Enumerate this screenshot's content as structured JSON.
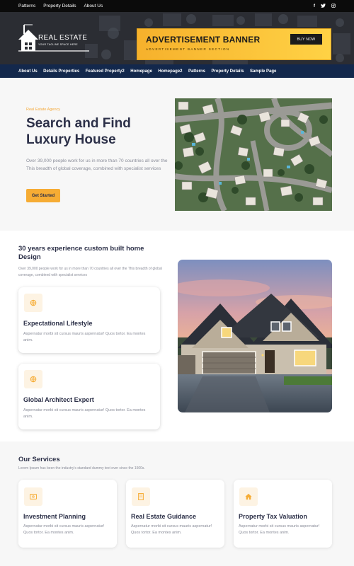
{
  "topbar": {
    "links": [
      "Patterns",
      "Property Details",
      "About Us"
    ],
    "social": [
      "f",
      "t",
      "o"
    ]
  },
  "header": {
    "logo_title": "REAL ESTATE",
    "logo_tagline": "YOUR TAGLINE SPACE HERE",
    "ad_title": "ADVERTISEMENT BANNER",
    "ad_subtitle": "ADVERTISEMENT BANNER SECTION",
    "ad_button": "BUY NOW"
  },
  "nav": {
    "items": [
      "About Us",
      "Details Properties",
      "Featured Property2",
      "Homepage",
      "Homepage2",
      "Patterns",
      "Property Details",
      "Sample Page"
    ]
  },
  "hero": {
    "tag": "Real Estate Agency",
    "title": "Search and Find Luxury House",
    "text": "Over 39,000 people work for us in more than 70 countries all over the This breadth of global coverage, combined with specialist services",
    "button": "Get Started"
  },
  "experience": {
    "title": "30 years experience custom built home Design",
    "text": "Over 39,000 people work for us in more than 70 countries all over the This breadth of global coverage, combined with specialist services",
    "features": [
      {
        "title": "Expectational Lifestyle",
        "desc": "Aspernatur morbi sit cursus mauris aspernatur! Quos tortor. Ea montes anim.",
        "icon": "globe-icon"
      },
      {
        "title": "Global Architect Expert",
        "desc": "Aspernatur morbi sit cursus mauris aspernatur! Quos tortor. Ea montes anim.",
        "icon": "globe-icon"
      }
    ]
  },
  "services": {
    "title": "Our Services",
    "subtitle": "Lorem Ipsum has been the industry's standard dummy text ever since the 1500s.",
    "cards": [
      {
        "title": "Investment Planning",
        "desc": "Aspernatur morbi sit cursus mauris aspernatur! Quos tortor. Ea montes anim.",
        "icon": "money-icon"
      },
      {
        "title": "Real Estate Guidance",
        "desc": "Aspernatur morbi sit cursus mauris aspernatur! Quos tortor. Ea montes anim.",
        "icon": "building-icon"
      },
      {
        "title": "Property Tax Valuation",
        "desc": "Aspernatur morbi sit cursus mauris aspernatur! Quos tortor. Ea montes anim.",
        "icon": "home-icon"
      }
    ]
  },
  "colors": {
    "accent": "#f6ac34",
    "nav_bg": "#13284c",
    "topbar_bg": "#0b0b0b",
    "heading": "#2c3048",
    "muted": "#8a8d99"
  }
}
